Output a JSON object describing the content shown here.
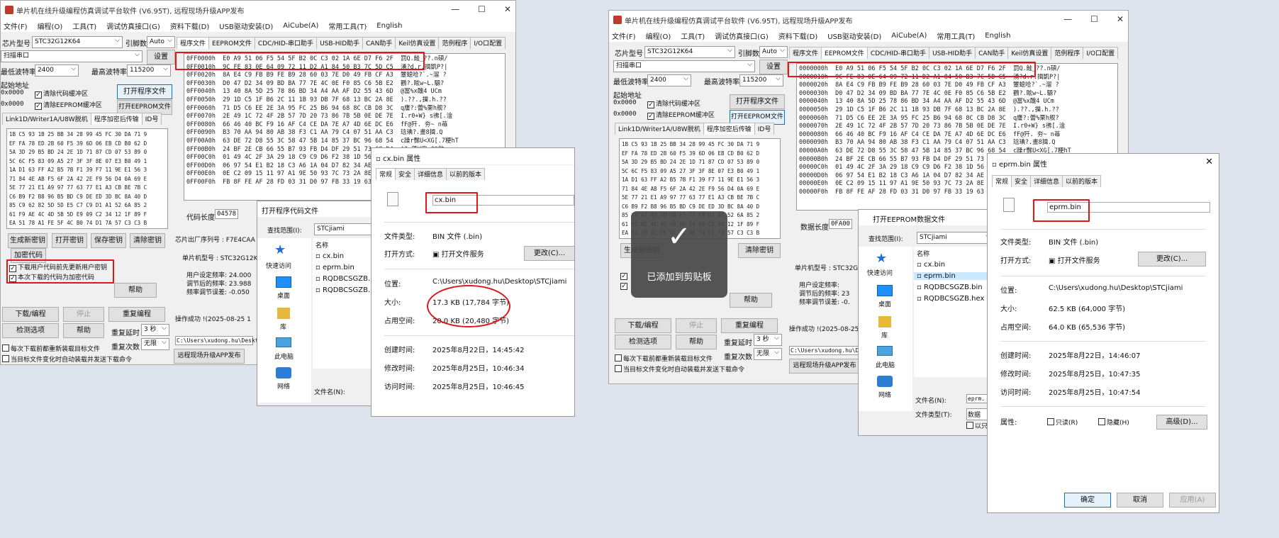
{
  "app": {
    "title": "单片机在线升级编程仿真调试平台软件 (V6.95T), 远程现场升级APP发布",
    "menu": [
      "文件(F)",
      "编程(O)",
      "工具(T)",
      "调试仿真接口(G)",
      "资料下载(D)",
      "USB驱动安装(D)",
      "AiCube(A)",
      "常用工具(T)",
      "English"
    ],
    "chip_label": "芯片型号",
    "chip_value": "STC32G12K64",
    "pin_label": "引脚数",
    "pin_value": "Auto",
    "scan_port": "扫描串口",
    "settings": "设置",
    "min_baud_label": "最低波特率",
    "min_baud": "2400",
    "max_baud_label": "最高波特率",
    "max_baud": "115200",
    "start_addr_label": "起始地址",
    "addr1": "0x0000",
    "addr2": "0x0000",
    "clear_code_buf": "清除代码缓冲区",
    "clear_eeprom_buf": "清除EEPROM缓冲区",
    "open_prog_file": "打开程序文件",
    "open_eeprom_file": "打开EEPROM文件",
    "tabs": [
      "程序文件",
      "EEPROM文件",
      "CDC/HID-串口助手",
      "USB-HID助手",
      "CAN助手",
      "Keil仿真设置",
      "范例程序",
      "I/O口配置"
    ],
    "left_tabs": [
      "Link1D/Writer1A/U8W脱机",
      "程序加密后传输",
      "ID号"
    ],
    "code_len_label": "代码长度",
    "code_len": "04578",
    "data_len_label": "数据长度",
    "data_len": "0FA00",
    "buttons": {
      "gen_key": "生成新密钥",
      "open_key": "打开密钥",
      "save_key": "保存密钥",
      "clear_key": "清除密钥",
      "encrypt": "加密代码",
      "help": "帮助",
      "download": "下载/编程",
      "stop": "停止",
      "reprog": "重复编程",
      "check": "检测选项",
      "help2": "帮助",
      "delay_label": "重复延时",
      "delay": "3 秒",
      "count_label": "重复次数",
      "count": "无限",
      "publish": "远程现场升级APP发布"
    },
    "chk_update_key": "下载用户代码前先更新用户密钥",
    "chk_encrypted": "本次下载的代码为加密代码",
    "chk_reload": "每次下载前都重新装载目标文件",
    "chk_auto": "当目标文件变化时自动装载并发送下载命令",
    "factory_label": "芯片出厂序列号 : F7E4CAA",
    "mcu_model": "单片机型号 : STC32G12K6",
    "info_lines": [
      "用户设定频率: 24.000",
      "调节后的频率: 23.988",
      "频率调节误差: -0.050"
    ],
    "info_lines_r": [
      "用户设定频率:",
      "调节后的频率: 23",
      "频率调节误差: -0."
    ],
    "status": "操作成功 !(2025-08-25 1",
    "path": "C:\\Users\\xudong.hu\\Deskto"
  },
  "hex_left": [
    "0FF0000h  E0 A9 51 06 F5 54 5F B2 0C C3 02 1A 6E D7 F6 2F",
    "0FF0010h  9C FE 83 0E 64 09 72 11 D2 A1 84 50 B3 7C 5D C5",
    "0FF0020h  8A E4 C9 FB B9 FE B9 28 60 03 7E D0 49 FB CF A3",
    "0FF0030h  D0 47 D2 34 09 BD BA 77 7E 4C 0E F0 85 C6 5B E2",
    "0FF0040h  13 40 8A 5D 25 78 86 BD 34 A4 AA AF D2 55 43 6D",
    "0FF0050h  29 1D C5 1F B6 2C 11 1B 93 DB 7F 68 13 BC 2A 8E",
    "0FF0060h  71 D5 C6 EE 2E 3A 95 FC 25 B6 94 68 8C CB D8 3C",
    "0FF0070h  2E 49 1C 72 4F 2B 57 7D 20 73 86 7B 5B 0E DE 7E",
    "0FF0080h  66 46 40 BC F9 16 AF C4 CE DA 7E A7 4D 6E DC E6",
    "0FF0090h  B3 70 AA 94 80 AB 38 F3 C1 AA 79 C4 07 51 AA C3",
    "0FF00A0h  63 DE 72 D8 55 3C 58 47 5B 14 85 37 BC 96 68 54",
    "0FF00B0h  24 BF 2E CB 66 55 B7 93 FB D4 DF 29 51 73 C8 D4",
    "0FF00C0h  01 49 4C 2F 3A 29 18 C9 C9 D6 F2 38 1D 56 E9 F7",
    "0FF00D0h  06 97 54 E1 B2 18 C3 A6 1A 04 D7 82 34 AE 5A C7",
    "0FF00E0h  0E C2 09 15 11 97 A1 9E 50 93 7C 73 2A 8E D2 F1",
    "0FF00F0h  FB 8F FE AF 28 FD 03 31 D0 97 FB 33 19 63 12 9A"
  ],
  "hex_right": [
    "0000000h  E0 A9 51 06 F5 54 5F B2 0C C3 02 1A 6E D7 F6 2F",
    "0000010h  9C FE 83 0E 64 09 72 11 D2 A1 84 50 B3 7C 5D C5",
    "0000020h  8A E4 C9 FB B9 FE B9 28 60 03 7E D0 49 FB CF A3",
    "0000030h  D0 47 D2 34 09 BD BA 77 7E 4C 0E F0 85 C6 5B E2",
    "0000040h  13 40 8A 5D 25 78 86 BD 34 A4 AA AF D2 55 43 6D",
    "0000050h  29 1D C5 1F B6 2C 11 1B 93 DB 7F 68 13 BC 2A 8E",
    "0000060h  71 D5 C6 EE 2E 3A 95 FC 25 B6 94 68 8C CB D8 3C",
    "0000070h  2E 49 1C 72 4F 2B 57 7D 20 73 86 7B 5B 0E DE 7E",
    "0000080h  66 46 40 BC F9 16 AF C4 CE DA 7E A7 4D 6E DC E6",
    "0000090h  B3 70 AA 94 80 AB 38 F3 C1 AA 79 C4 07 51 AA C3",
    "00000A0h  63 DE 72 D8 55 3C 58 47 5B 14 85 37 BC 96 68 54",
    "00000B0h  24 BF 2E CB 66 55 B7 93 FB D4 DF 29 51 73 C8 D4",
    "00000C0h  01 49 4C 2F 3A 29 18 C9 C9 D6 F2 38 1D 56 E9 F7",
    "00000D0h  06 97 54 E1 B2 18 C3 A6 1A 04 D7 82 34 AE 5A C7",
    "00000E0h  0E C2 09 15 11 97 A1 9E 50 93 7C 73 2A 8E D2 F1",
    "00000F0h  FB 8F FE AF 28 FD 03 31 D0 97 FB 33 19 63 12 9A"
  ],
  "ascii": [
    "罰Q.鮭_??.n碩/",
    "湧?d.r.揖凱P?|",
    "簺螅哈?`.~溜 ?",
    "鸐?.眩w~L.騵?",
    "@冨%x醜4 UCm",
    ").??.,摷.h.??",
    "q譍?:蕾%栗h舰?",
    "I.r0+W} s彿[.淦",
    "fF@歼. 夯~ n苺",
    "琀琠?.畫8揖.Q",
    "c躁r豒U<XG[.7粳hT",
    "$?.薳U窊.?Q歙",
    "IL/:).缨?.V",
    "?T岵..?.4甠?",
    "?椏.P搭s*庐?",
    "?瀆..1袟?c.?"
  ],
  "small_hex": [
    "1B C5 93 1B 25 BB 34 28 99 45 FC 30 DA 71 9",
    "EF FA 78 ED 2B 60 F5 39 6D 06 EB CD B0 62 D",
    "5A 3D 29 B5 BD 24 2E 1D 71 87 CD 07 53 89 0",
    "5C 6C F5 83 09 A5 27 3F 3F 8E 07 E3 B0 49 1",
    "1A D1 63 FF A2 B5 7B F1 39 F7 11 9E E1 56 3",
    "71 84 4E AB F5 6F 2A 42 2E F9 56 D4 0A 69 E",
    "5E 77 21 E1 A9 97 77 63 77 E1 A3 CB BE 7B C",
    "C6 B9 F2 B8 96 B5 BD C9 DE ED 3D BC 8A 40 D",
    "85 C9 62 82 5D 5D E5 C7 C9 D1 A1 52 6A 85 2",
    "61 F9 AE 4C 4D 5B 5D E9 09 C2 34 12 1F 89 F",
    "EA 51 78 A1 FE 5F 4C B0 74 D1 7A 57 C3 C3 B"
  ],
  "props_left": {
    "title": "cx.bin 属性",
    "tabs": [
      "常规",
      "安全",
      "详细信息",
      "以前的版本"
    ],
    "filename": "cx.bin",
    "type_label": "文件类型:",
    "type": "BIN 文件 (.bin)",
    "open_label": "打开方式:",
    "open": "打开文件服务",
    "change": "更改(C)...",
    "loc_label": "位置:",
    "loc": "C:\\Users\\xudong.hu\\Desktop\\STCjiami",
    "size_label": "大小:",
    "size": "17.3 KB (17,784 字节)",
    "disk_label": "占用空间:",
    "disk": "20.0 KB (20,480 字节)",
    "created_label": "创建时间:",
    "created": "2025年8月22日，14:45:42",
    "modified_label": "修改时间:",
    "modified": "2025年8月25日，10:46:34",
    "accessed_label": "访问时间:",
    "accessed": "2025年8月25日，10:46:45"
  },
  "props_right": {
    "title": "eprm.bin 属性",
    "tabs": [
      "常规",
      "安全",
      "详细信息",
      "以前的版本"
    ],
    "filename": "eprm.bin",
    "type_label": "文件类型:",
    "type": "BIN 文件 (.bin)",
    "open_label": "打开方式:",
    "open": "打开文件服务",
    "change": "更改(C)...",
    "loc_label": "位置:",
    "loc": "C:\\Users\\xudong.hu\\Desktop\\STCjiami",
    "size_label": "大小:",
    "size": "62.5 KB (64,000 字节)",
    "disk_label": "占用空间:",
    "disk": "64.0 KB (65,536 字节)",
    "created_label": "创建时间:",
    "created": "2025年8月22日，14:46:07",
    "modified_label": "修改时间:",
    "modified": "2025年8月25日，10:47:35",
    "accessed_label": "访问时间:",
    "accessed": "2025年8月25日，10:47:54",
    "attr_label": "属性:",
    "readonly": "只读(R)",
    "hidden": "隐藏(H)",
    "advanced": "高级(D)...",
    "ok": "确定",
    "cancel": "取消",
    "apply": "应用(A)"
  },
  "open_left": {
    "title": "打开程序代码文件",
    "lookin": "查找范围(I):",
    "folder": "STCjiami",
    "name_col": "名称",
    "files": [
      "cx.bin",
      "eprm.bin",
      "RQDBCSGZB.l",
      "RQDBCSGZB.l"
    ],
    "places": [
      "快速访问",
      "桌面",
      "库",
      "此电脑",
      "网络"
    ],
    "fname_label": "文件名(N):"
  },
  "open_right": {
    "title": "打开EEPROM数据文件",
    "lookin": "查找范围(I):",
    "folder": "STCjiami",
    "name_col": "名称",
    "files": [
      "cx.bin",
      "eprm.bin",
      "RQDBCSGZB.bin",
      "RQDBCSGZB.hex"
    ],
    "places": [
      "快速访问",
      "桌面",
      "库",
      "此电脑",
      "网络"
    ],
    "fname_label": "文件名(N):",
    "ftype_label": "文件类型(T):",
    "fname": "eprm.",
    "ftype": "数据",
    "readonly": "以只"
  },
  "toast": "已添加到剪贴板"
}
